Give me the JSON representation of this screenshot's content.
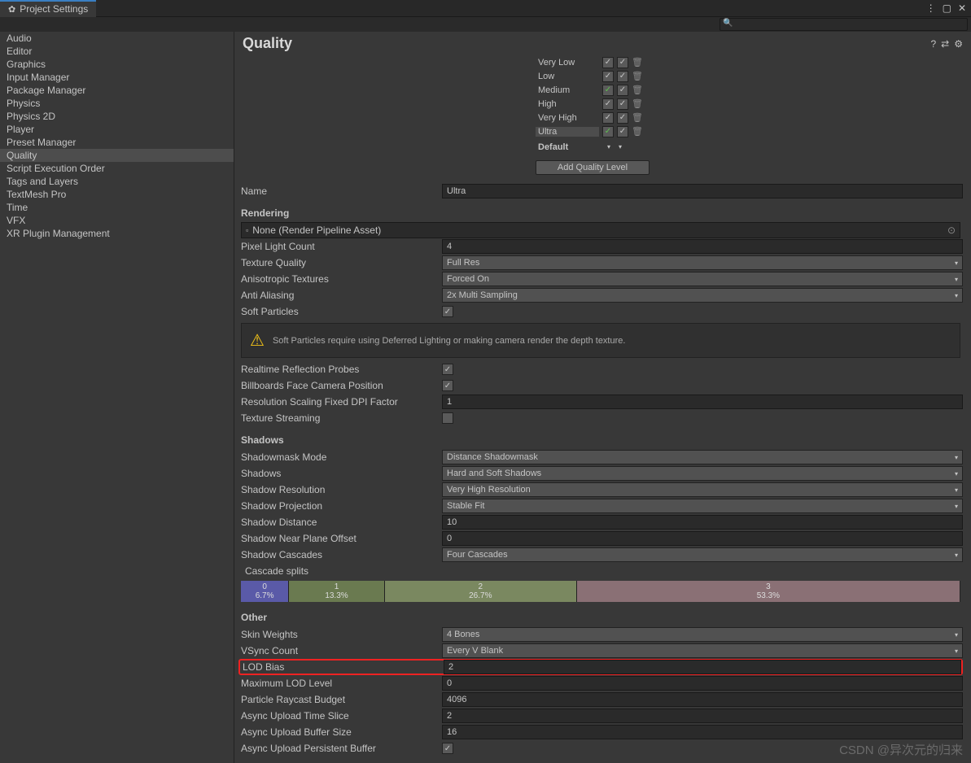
{
  "window": {
    "title": "Project Settings"
  },
  "search": {
    "placeholder": ""
  },
  "sidebar": {
    "items": [
      {
        "label": "Audio"
      },
      {
        "label": "Editor"
      },
      {
        "label": "Graphics"
      },
      {
        "label": "Input Manager"
      },
      {
        "label": "Package Manager"
      },
      {
        "label": "Physics"
      },
      {
        "label": "Physics 2D"
      },
      {
        "label": "Player"
      },
      {
        "label": "Preset Manager"
      },
      {
        "label": "Quality",
        "selected": true
      },
      {
        "label": "Script Execution Order"
      },
      {
        "label": "Tags and Layers"
      },
      {
        "label": "TextMesh Pro"
      },
      {
        "label": "Time"
      },
      {
        "label": "VFX"
      },
      {
        "label": "XR Plugin Management"
      }
    ]
  },
  "content": {
    "title": "Quality",
    "levels": [
      {
        "label": "Very Low",
        "c1": true,
        "c2": true,
        "c1green": false
      },
      {
        "label": "Low",
        "c1": true,
        "c2": true,
        "c1green": false
      },
      {
        "label": "Medium",
        "c1": true,
        "c2": true,
        "c1green": true
      },
      {
        "label": "High",
        "c1": true,
        "c2": true,
        "c1green": false
      },
      {
        "label": "Very High",
        "c1": true,
        "c2": true,
        "c1green": false
      },
      {
        "label": "Ultra",
        "c1": true,
        "c2": true,
        "c1green": true,
        "current": true
      }
    ],
    "default_label": "Default",
    "add_level_btn": "Add Quality Level",
    "name_label": "Name",
    "name_value": "Ultra",
    "rendering_header": "Rendering",
    "pipeline_value": "None (Render Pipeline Asset)",
    "fields_rendering": [
      {
        "label": "Pixel Light Count",
        "type": "text",
        "value": "4"
      },
      {
        "label": "Texture Quality",
        "type": "dropdown",
        "value": "Full Res"
      },
      {
        "label": "Anisotropic Textures",
        "type": "dropdown",
        "value": "Forced On"
      },
      {
        "label": "Anti Aliasing",
        "type": "dropdown",
        "value": "2x Multi Sampling"
      },
      {
        "label": "Soft Particles",
        "type": "checkbox",
        "checked": true
      }
    ],
    "soft_particles_info": "Soft Particles require using Deferred Lighting or making camera render the depth texture.",
    "fields_rendering2": [
      {
        "label": "Realtime Reflection Probes",
        "type": "checkbox",
        "checked": true
      },
      {
        "label": "Billboards Face Camera Position",
        "type": "checkbox",
        "checked": true
      },
      {
        "label": "Resolution Scaling Fixed DPI Factor",
        "type": "text",
        "value": "1"
      },
      {
        "label": "Texture Streaming",
        "type": "checkbox",
        "checked": false
      }
    ],
    "shadows_header": "Shadows",
    "fields_shadows": [
      {
        "label": "Shadowmask Mode",
        "type": "dropdown",
        "value": "Distance Shadowmask"
      },
      {
        "label": "Shadows",
        "type": "dropdown",
        "value": "Hard and Soft Shadows"
      },
      {
        "label": "Shadow Resolution",
        "type": "dropdown",
        "value": "Very High Resolution"
      },
      {
        "label": "Shadow Projection",
        "type": "dropdown",
        "value": "Stable Fit"
      },
      {
        "label": "Shadow Distance",
        "type": "text",
        "value": "10"
      },
      {
        "label": "Shadow Near Plane Offset",
        "type": "text",
        "value": "0"
      },
      {
        "label": "Shadow Cascades",
        "type": "dropdown",
        "value": "Four Cascades"
      }
    ],
    "cascade_label": "Cascade splits",
    "cascade_segments": [
      {
        "idx": "0",
        "pct": "6.7%"
      },
      {
        "idx": "1",
        "pct": "13.3%"
      },
      {
        "idx": "2",
        "pct": "26.7%"
      },
      {
        "idx": "3",
        "pct": "53.3%"
      }
    ],
    "other_header": "Other",
    "fields_other": [
      {
        "label": "Skin Weights",
        "type": "dropdown",
        "value": "4 Bones"
      },
      {
        "label": "VSync Count",
        "type": "dropdown",
        "value": "Every V Blank"
      },
      {
        "label": "LOD Bias",
        "type": "text",
        "value": "2",
        "highlight": true
      },
      {
        "label": "Maximum LOD Level",
        "type": "text",
        "value": "0"
      },
      {
        "label": "Particle Raycast Budget",
        "type": "text",
        "value": "4096"
      },
      {
        "label": "Async Upload Time Slice",
        "type": "text",
        "value": "2"
      },
      {
        "label": "Async Upload Buffer Size",
        "type": "text",
        "value": "16"
      },
      {
        "label": "Async Upload Persistent Buffer",
        "type": "checkbox",
        "checked": true
      }
    ]
  },
  "watermark": "CSDN @异次元的归来"
}
